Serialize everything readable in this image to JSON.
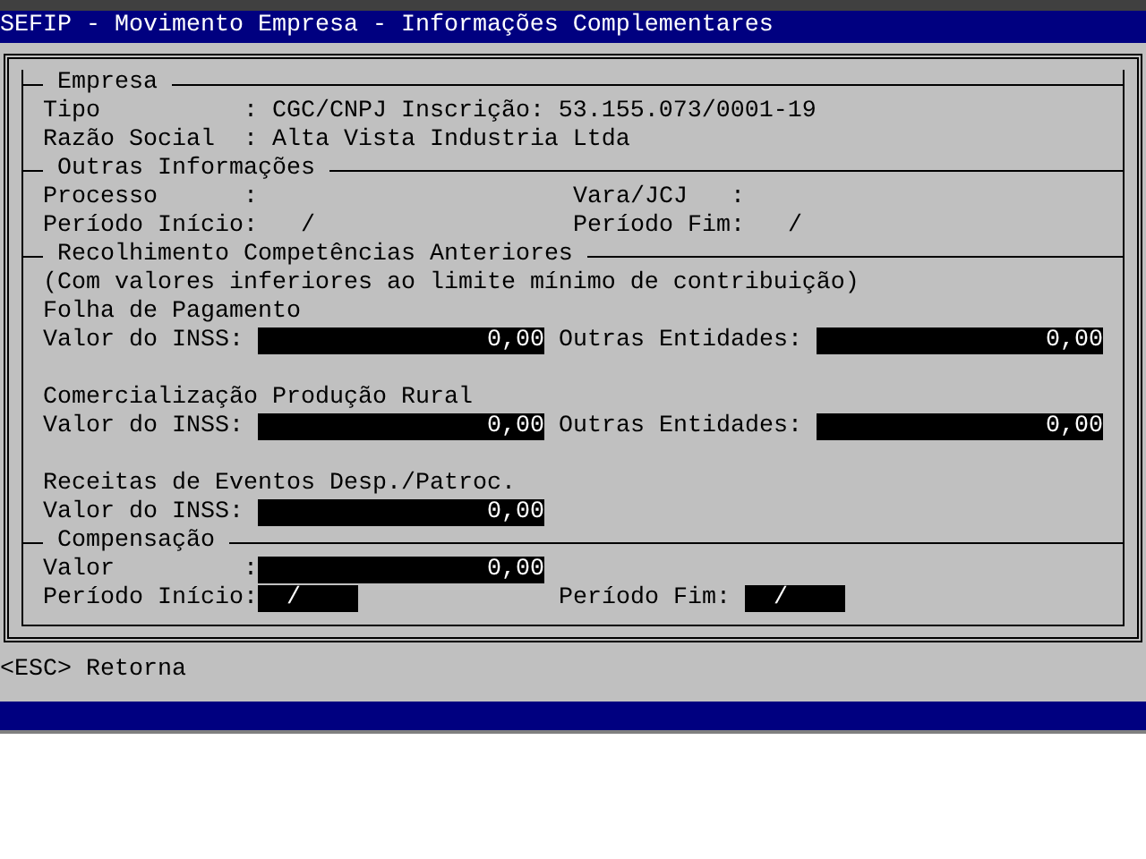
{
  "window": {
    "title": "SEFIP - Movimento Empresa - Informações Complementares"
  },
  "sections": [
    {
      "title": "Empresa",
      "rows": [
        {
          "left": [
            {
              "kind": "text",
              "text": "Tipo          : CGC/CNPJ Inscrição: 53.155.073/0001-19"
            }
          ]
        },
        {
          "left": [
            {
              "kind": "text",
              "text": "Razão Social  : Alta Vista Industria Ltda"
            }
          ]
        }
      ]
    },
    {
      "title": "Outras Informações",
      "rows": [
        {
          "left": [
            {
              "kind": "text",
              "text": "Processo      :"
            }
          ],
          "right": [
            {
              "kind": "text",
              "text": "Vara/JCJ   :"
            }
          ]
        },
        {
          "left": [
            {
              "kind": "text",
              "text": "Período Início:   /"
            }
          ],
          "right": [
            {
              "kind": "text",
              "text": "Período Fim:   /"
            }
          ]
        }
      ]
    },
    {
      "title": "Recolhimento Competências Anteriores",
      "rows": [
        {
          "left": [
            {
              "kind": "text",
              "text": "(Com valores inferiores ao limite mínimo de contribuição)"
            }
          ]
        },
        {
          "left": [
            {
              "kind": "text",
              "text": "Folha de Pagamento"
            }
          ]
        },
        {
          "left": [
            {
              "kind": "label",
              "text": "Valor do INSS:"
            },
            {
              "kind": "amount",
              "value": "0,00"
            }
          ],
          "right": [
            {
              "kind": "label",
              "text": "Outras Entidades:"
            },
            {
              "kind": "amount",
              "value": "0,00"
            }
          ]
        },
        {
          "left": []
        },
        {
          "left": [
            {
              "kind": "text",
              "text": "Comercialização Produção Rural"
            }
          ]
        },
        {
          "left": [
            {
              "kind": "label",
              "text": "Valor do INSS:"
            },
            {
              "kind": "amount",
              "value": "0,00"
            }
          ],
          "right": [
            {
              "kind": "label",
              "text": "Outras Entidades:"
            },
            {
              "kind": "amount",
              "value": "0,00"
            }
          ]
        },
        {
          "left": []
        },
        {
          "left": [
            {
              "kind": "text",
              "text": "Receitas de Eventos Desp./Patroc."
            }
          ]
        },
        {
          "left": [
            {
              "kind": "label",
              "text": "Valor do INSS:"
            },
            {
              "kind": "amount",
              "value": "0,00"
            }
          ]
        }
      ]
    },
    {
      "title": "Compensação",
      "rows": [
        {
          "left": [
            {
              "kind": "label",
              "text": "Valor         :"
            },
            {
              "kind": "amount",
              "value": "0,00"
            }
          ]
        },
        {
          "left": [
            {
              "kind": "label",
              "text": "Período Início:"
            },
            {
              "kind": "period",
              "value": "/"
            }
          ],
          "right": [
            {
              "kind": "label",
              "text": "Período Fim:"
            },
            {
              "kind": "period",
              "value": "/"
            }
          ]
        }
      ]
    }
  ],
  "status_bar": "<ESC> Retorna"
}
